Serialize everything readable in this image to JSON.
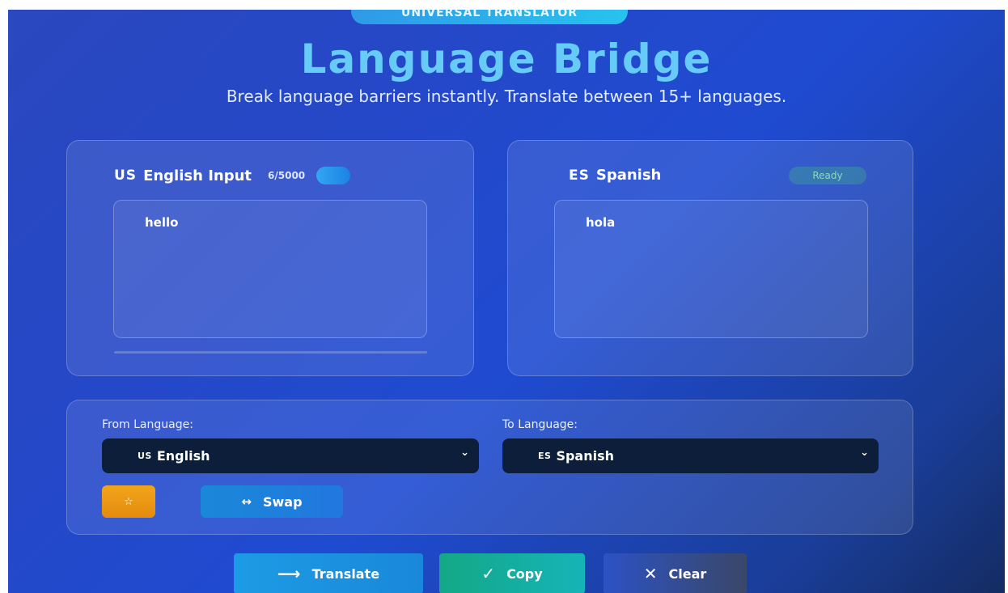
{
  "header": {
    "badge": "UNIVERSAL TRANSLATOR",
    "title": "Language Bridge",
    "subtitle": "Break language barriers instantly. Translate between 15+ languages."
  },
  "input_panel": {
    "flag": "US",
    "title": "English Input",
    "counter": "6/5000",
    "text": "hello"
  },
  "output_panel": {
    "flag": "ES",
    "title": "Spanish",
    "status": "Ready",
    "text": "hola"
  },
  "language_select": {
    "from_label": "From Language:",
    "from_flag": "US",
    "from_value": "English",
    "to_label": "To Language:",
    "to_flag": "ES",
    "to_value": "Spanish",
    "chevron": "⌄",
    "star_icon": "☆",
    "swap_icon": "↔",
    "swap_label": "Swap"
  },
  "actions": {
    "translate_icon": "⟶",
    "translate_label": "Translate",
    "copy_icon": "✓",
    "copy_label": "Copy",
    "clear_icon": "✕",
    "clear_label": "Clear"
  }
}
